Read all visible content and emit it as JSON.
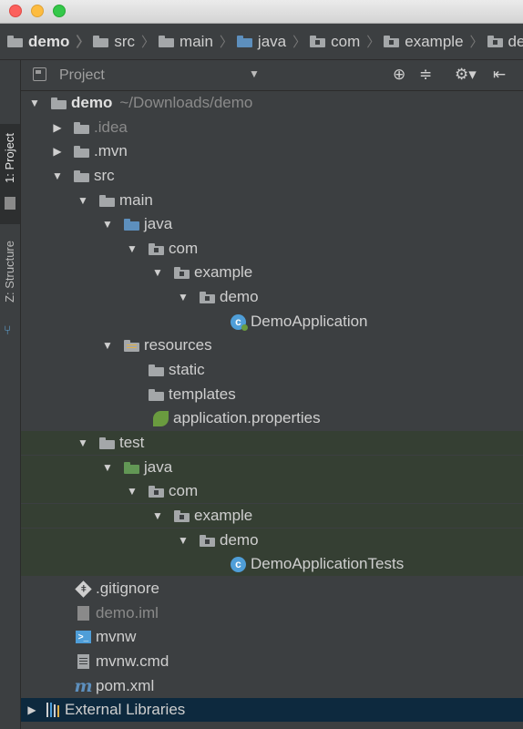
{
  "breadcrumb": [
    {
      "label": "demo",
      "bold": true
    },
    {
      "label": "src"
    },
    {
      "label": "main"
    },
    {
      "label": "java"
    },
    {
      "label": "com"
    },
    {
      "label": "example"
    },
    {
      "label": "dem"
    }
  ],
  "side_tabs": {
    "project": "1: Project",
    "structure": "Z: Structure"
  },
  "panel": {
    "view_label": "Project"
  },
  "tree": {
    "root_label": "demo",
    "root_path": "~/Downloads/demo",
    "idea": ".idea",
    "mvn": ".mvn",
    "src": "src",
    "main": "main",
    "main_java": "java",
    "main_com": "com",
    "main_example": "example",
    "main_demo": "demo",
    "demo_application": "DemoApplication",
    "resources": "resources",
    "static": "static",
    "templates": "templates",
    "app_props": "application.properties",
    "test": "test",
    "test_java": "java",
    "test_com": "com",
    "test_example": "example",
    "test_demo": "demo",
    "demo_tests": "DemoApplicationTests",
    "gitignore": ".gitignore",
    "demo_iml": "demo.iml",
    "mvnw": "mvnw",
    "mvnw_cmd": "mvnw.cmd",
    "pom": "pom.xml",
    "external_libs": "External Libraries"
  },
  "colors": {
    "background": "#3c3f41",
    "selection": "#0d293e",
    "test_bg": "#353f33",
    "source_folder": "#5d8fbd"
  }
}
